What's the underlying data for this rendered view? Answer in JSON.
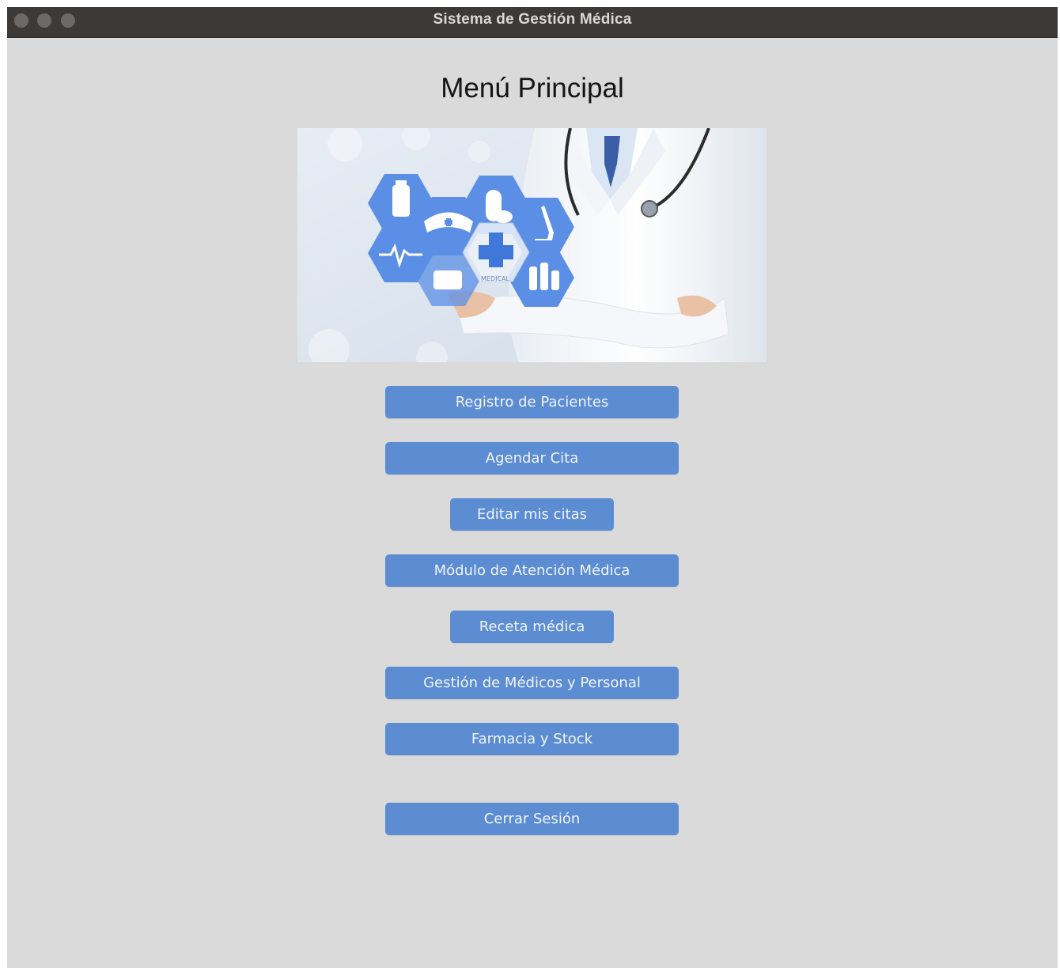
{
  "window": {
    "title": "Sistema de Gestión Médica"
  },
  "main": {
    "heading": "Menú Principal",
    "banner_image": "doctor-medical-icons-banner",
    "buttons": [
      {
        "label": "Registro de Pacientes"
      },
      {
        "label": "Agendar Cita"
      },
      {
        "label": "Editar mis citas"
      },
      {
        "label": "Módulo de Atención Médica"
      },
      {
        "label": "Receta médica"
      },
      {
        "label": "Gestión de Médicos y Personal"
      },
      {
        "label": "Farmacia y Stock"
      },
      {
        "label": "Cerrar Sesión"
      }
    ]
  },
  "colors": {
    "button_bg": "#5c8dd3",
    "window_bg": "#dadada",
    "titlebar_bg": "#3b3a39",
    "icon_blue": "#5b8fe6"
  }
}
